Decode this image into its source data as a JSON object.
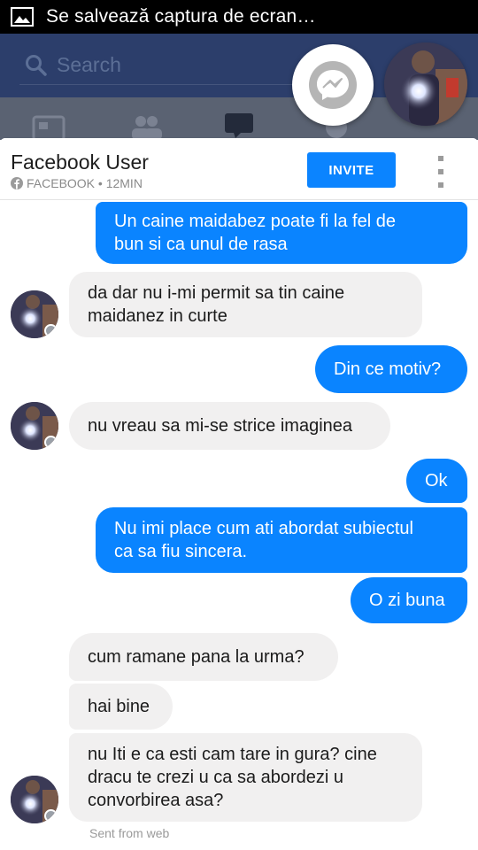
{
  "status_bar": {
    "notification_text": "Se salvează captura de ecran…",
    "icon": "image-icon"
  },
  "facebook_app": {
    "search_placeholder": "Search",
    "tabs": [
      "news-feed-icon",
      "friends-icon",
      "messages-icon",
      "notifications-icon",
      "menu-icon"
    ],
    "colors": {
      "header": "#2c3e6b",
      "tabbar": "#5a6272"
    }
  },
  "chat_heads": {
    "messenger_icon": "messenger-icon",
    "contact_avatar": "avatar"
  },
  "chat": {
    "contact_name": "Facebook User",
    "contact_source": "FACEBOOK • 12MIN",
    "invite_label": "INVITE",
    "more_icon": "more-vertical-icon",
    "colors": {
      "outgoing": "#0a84ff",
      "incoming": "#f1f0f0",
      "invite": "#0b84ff"
    },
    "messages": [
      {
        "from": "me",
        "lines": [
          "Un caine maidabez poate fi la fel de",
          "bun si ca unul de rasa"
        ]
      },
      {
        "from": "them",
        "lines": [
          "da dar nu i-mi permit sa tin caine",
          "maidanez in curte"
        ]
      },
      {
        "from": "me",
        "lines": [
          "Din ce motiv?"
        ]
      },
      {
        "from": "them",
        "lines": [
          "nu vreau sa mi-se strice imaginea"
        ]
      },
      {
        "from": "me",
        "lines": [
          "Ok"
        ]
      },
      {
        "from": "me",
        "lines": [
          "Nu imi place cum ati abordat subiectul",
          "ca sa fiu sincera."
        ]
      },
      {
        "from": "me",
        "lines": [
          "O zi buna"
        ]
      },
      {
        "from": "them",
        "lines": [
          "cum ramane pana la urma?"
        ]
      },
      {
        "from": "them",
        "lines": [
          "hai bine"
        ]
      },
      {
        "from": "them",
        "lines": [
          "nu Iti e ca esti cam tare in gura? cine",
          "dracu te crezi u ca sa abordezi u",
          "convorbirea asa?"
        ]
      }
    ],
    "sent_from": "Sent from web"
  }
}
